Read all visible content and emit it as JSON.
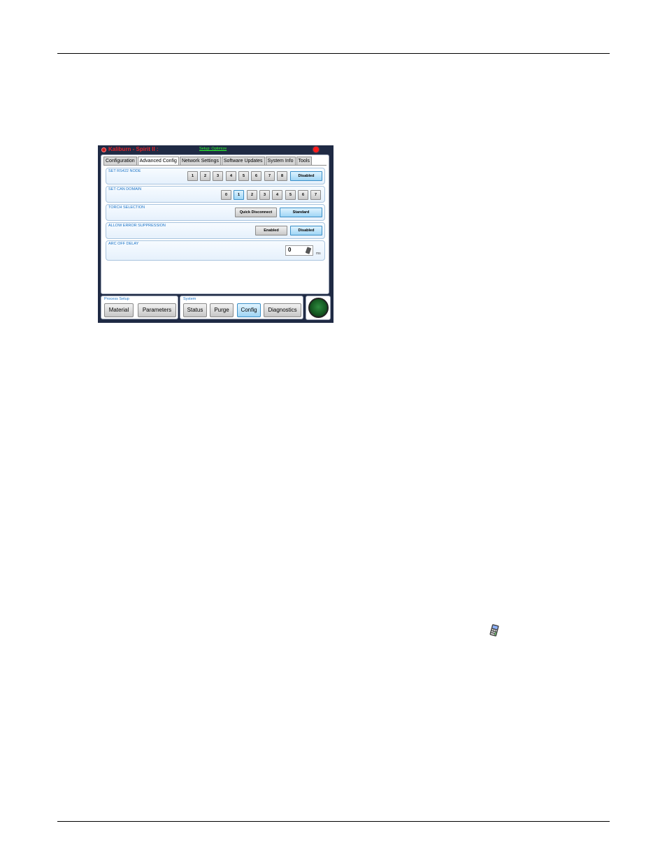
{
  "window": {
    "title": "Kaliburn - Spirit II :",
    "status_link": "Setup: Optimize"
  },
  "tabs": [
    "Configuration",
    "Advanced Config",
    "Network Settings",
    "Software Updates",
    "System Info",
    "Tools"
  ],
  "active_tab": "Advanced Config",
  "rs422": {
    "label": "SET RS422 NODE",
    "options": [
      "1",
      "2",
      "3",
      "4",
      "5",
      "6",
      "7",
      "8"
    ],
    "disabled_label": "Disabled",
    "selected": "Disabled"
  },
  "can": {
    "label": "SET CAN DOMAIN",
    "options": [
      "0",
      "1",
      "2",
      "3",
      "4",
      "5",
      "6",
      "7"
    ],
    "selected": "1"
  },
  "torch": {
    "label": "TORCH SELECTION",
    "quick_disconnect": "Quick Disconnect",
    "standard": "Standard",
    "selected": "Standard"
  },
  "error_suppression": {
    "label": "ALLOW ERROR SUPPRESSION",
    "enabled": "Enabled",
    "disabled": "Disabled",
    "selected": "Disabled"
  },
  "arc_off_delay": {
    "label": "ARC OFF DELAY",
    "value": "0",
    "unit": "ms"
  },
  "process_setup": {
    "label": "Process Setup",
    "material": "Material",
    "parameters": "Parameters"
  },
  "system": {
    "label": "System",
    "status": "Status",
    "purge": "Purge",
    "config": "Config",
    "diagnostics": "Diagnostics",
    "selected": "Config"
  },
  "colors": {
    "title": "#e0242a",
    "group_label": "#1a73c7",
    "selected_button": "#9fd5f5",
    "status_link": "#2cff2c",
    "frame": "#1f2a44"
  }
}
